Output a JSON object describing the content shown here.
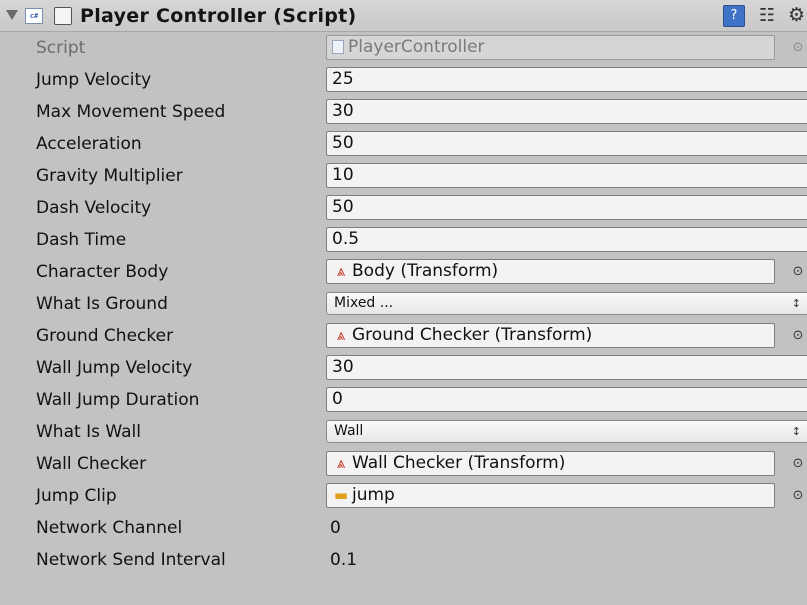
{
  "component": {
    "title": "Player Controller (Script)",
    "icon_text": "c#",
    "help_glyph": "?",
    "preset_glyph": "☷",
    "gear_glyph": "⚙"
  },
  "picker_glyph": "⊙",
  "dropdown_arrow": "↕",
  "fields": {
    "script": {
      "label": "Script",
      "value": "PlayerController"
    },
    "jump_velocity": {
      "label": "Jump Velocity",
      "value": "25"
    },
    "max_movement_speed": {
      "label": "Max Movement Speed",
      "value": "30"
    },
    "acceleration": {
      "label": "Acceleration",
      "value": "50"
    },
    "gravity_multiplier": {
      "label": "Gravity Multiplier",
      "value": "10"
    },
    "dash_velocity": {
      "label": "Dash Velocity",
      "value": "50"
    },
    "dash_time": {
      "label": "Dash Time",
      "value": "0.5"
    },
    "character_body": {
      "label": "Character Body",
      "value": "Body (Transform)",
      "icon_glyph": "⩓"
    },
    "what_is_ground": {
      "label": "What Is Ground",
      "value": "Mixed ..."
    },
    "ground_checker": {
      "label": "Ground Checker",
      "value": "Ground Checker (Transform)",
      "icon_glyph": "⩓"
    },
    "wall_jump_velocity": {
      "label": "Wall Jump Velocity",
      "value": "30"
    },
    "wall_jump_duration": {
      "label": "Wall Jump Duration",
      "value": "0"
    },
    "what_is_wall": {
      "label": "What Is Wall",
      "value": "Wall"
    },
    "wall_checker": {
      "label": "Wall Checker",
      "value": "Wall Checker (Transform)",
      "icon_glyph": "⩓"
    },
    "jump_clip": {
      "label": "Jump Clip",
      "value": "jump",
      "icon_glyph": "▬"
    },
    "network_channel": {
      "label": "Network Channel",
      "value": "0"
    },
    "network_send_interval": {
      "label": "Network Send Interval",
      "value": "0.1"
    }
  }
}
